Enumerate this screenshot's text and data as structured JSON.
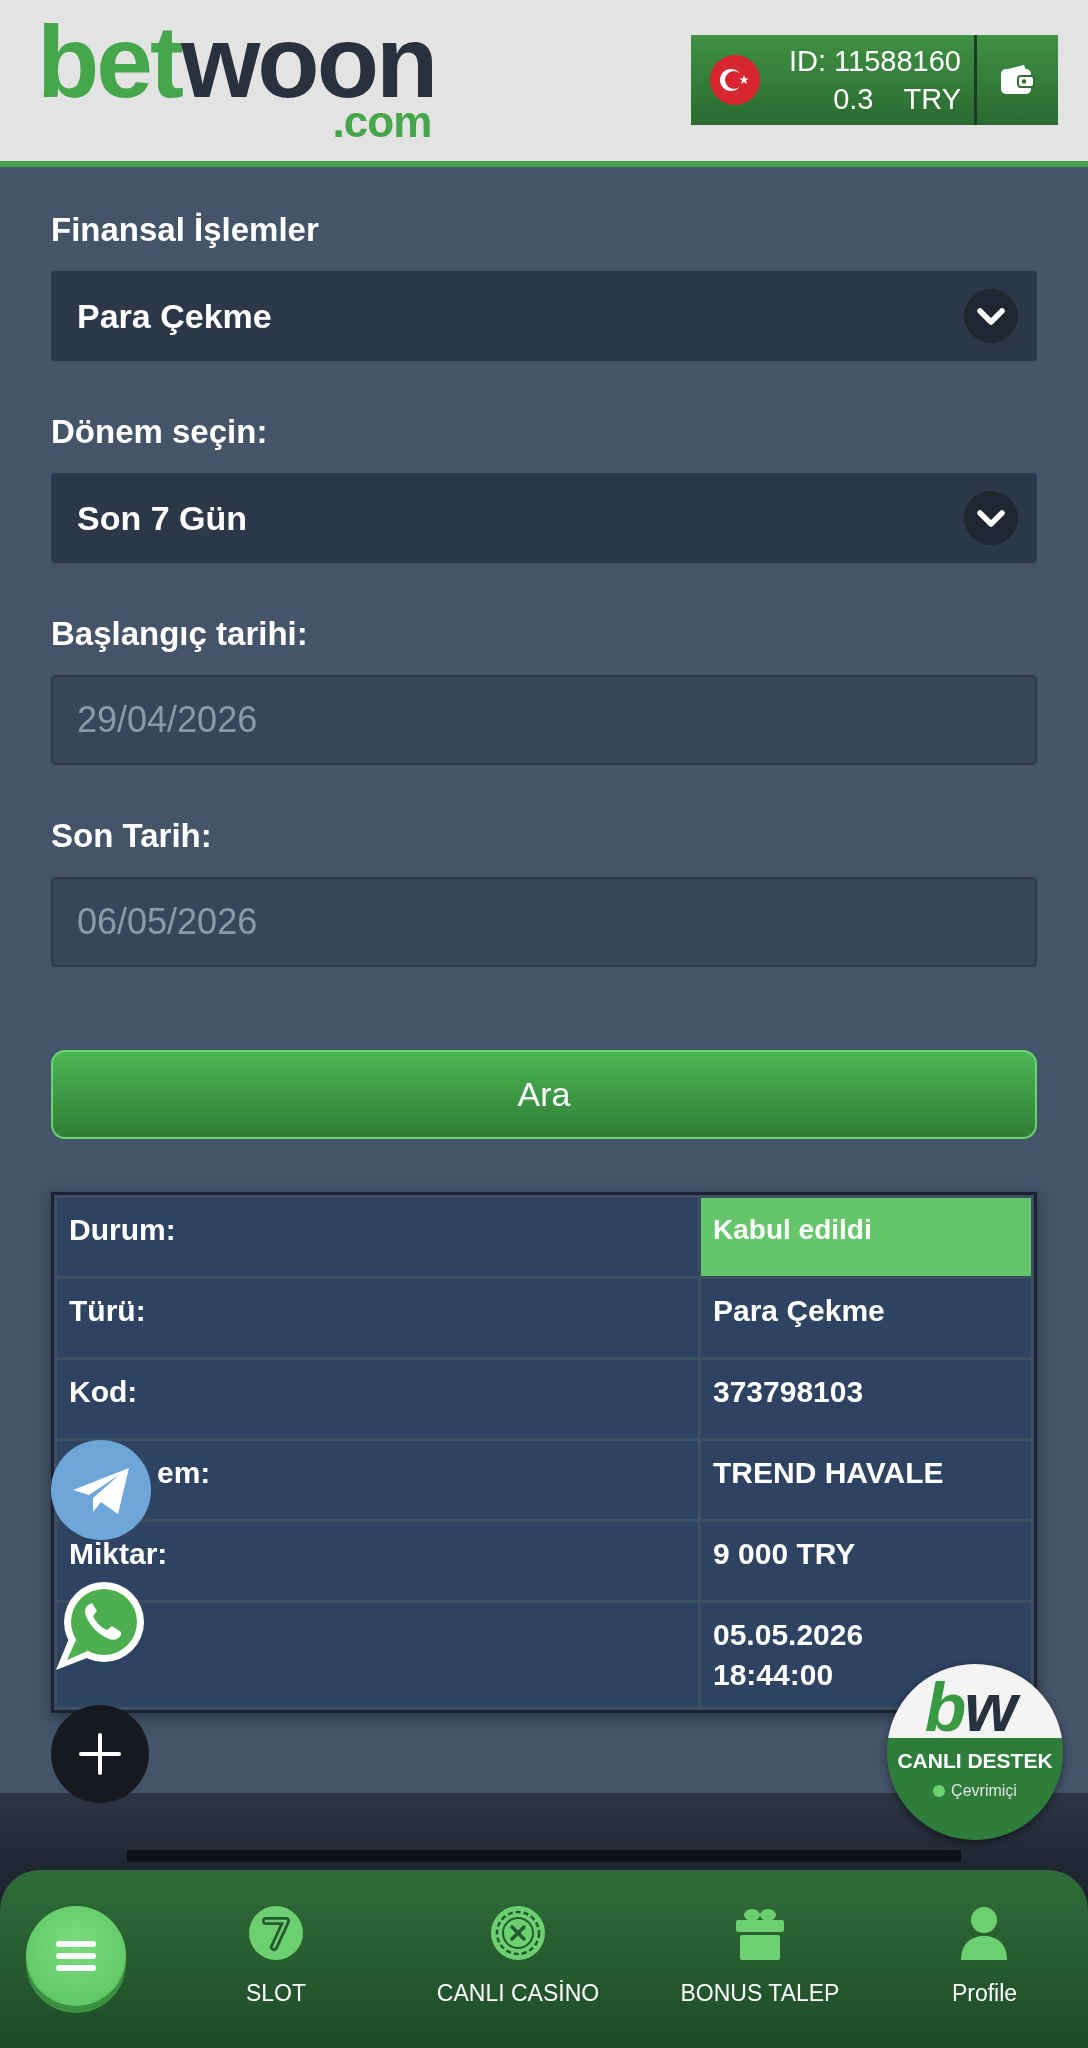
{
  "header": {
    "logo": {
      "first": "bet",
      "second": "woon",
      "suffix": ".com"
    },
    "account": {
      "id": "ID: 11588160",
      "balance": "0.3",
      "currency": "TRY"
    }
  },
  "form": {
    "fields": [
      {
        "kind": "select",
        "label": "Finansal İşlemler",
        "value": "Para Çekme",
        "disabled": false
      },
      {
        "kind": "select",
        "label": "Dönem seçin:",
        "value": "Son 7 Gün",
        "disabled": false
      },
      {
        "kind": "date",
        "label": "Başlangıç tarihi:",
        "value": "29/04/2026",
        "disabled": true
      },
      {
        "kind": "date",
        "label": "Son Tarih:",
        "value": "06/05/2026",
        "disabled": true
      }
    ],
    "search_button": "Ara"
  },
  "details": {
    "rows": [
      {
        "kind": "status",
        "label": "Durum:",
        "value": "Kabul edildi"
      },
      {
        "kind": "text",
        "label": "Türü:",
        "value": "Para Çekme"
      },
      {
        "kind": "text",
        "label": "Kod:",
        "value": "373798103"
      },
      {
        "kind": "text",
        "label": "em:",
        "value": "TREND HAVALE"
      },
      {
        "kind": "text",
        "label": "Miktar:",
        "value": "9 000 TRY"
      },
      {
        "kind": "datetime",
        "date": "05.05.2026",
        "time": "18:44:00"
      }
    ]
  },
  "live_support": {
    "logo": {
      "first": "b",
      "second": "w"
    },
    "title": "CANLI DESTEK",
    "status": "Çevrimiçi",
    "online": true
  },
  "bottom_nav": {
    "items": [
      {
        "label": "SLOT"
      },
      {
        "label": "CANLI CASİNO"
      },
      {
        "label": "BONUS TALEP"
      },
      {
        "label": "Profile"
      }
    ]
  }
}
